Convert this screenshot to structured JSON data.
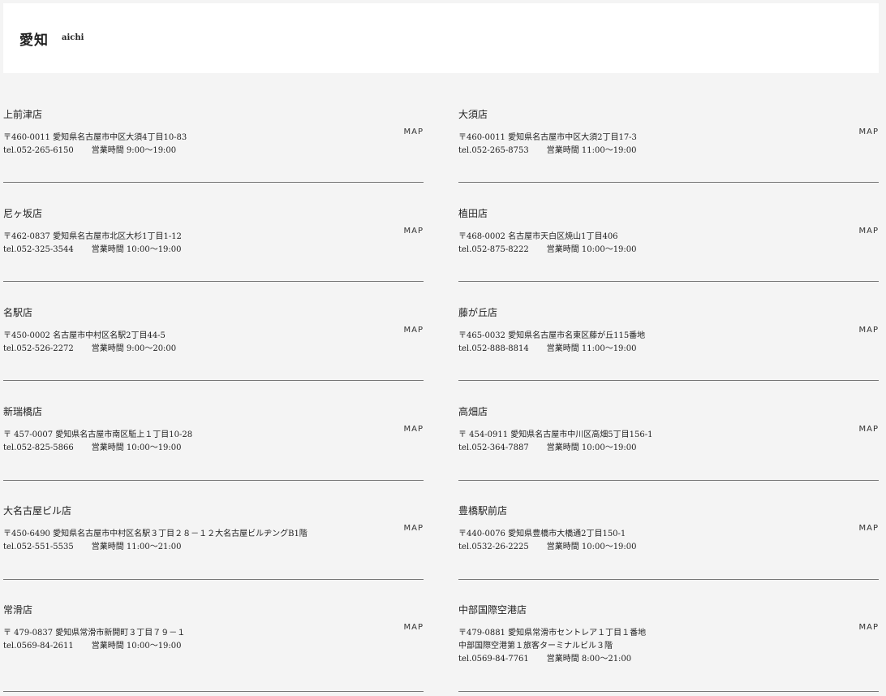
{
  "header": {
    "title": "愛知",
    "subtitle": "aichi"
  },
  "map_label": "MAP",
  "stores": [
    {
      "name": "上前津店",
      "address": "〒460-0011 愛知県名古屋市中区大須4丁目10-83",
      "tel": "tel.052-265-6150",
      "hours": "営業時間 9:00～19:00"
    },
    {
      "name": "大須店",
      "address": "〒460-0011 愛知県名古屋市中区大須2丁目17-3",
      "tel": "tel.052-265-8753",
      "hours": "営業時間 11:00～19:00"
    },
    {
      "name": "尼ヶ坂店",
      "address": "〒462-0837 愛知県名古屋市北区大杉1丁目1-12",
      "tel": "tel.052-325-3544",
      "hours": "営業時間 10:00～19:00"
    },
    {
      "name": "植田店",
      "address": "〒468-0002 名古屋市天白区焼山1丁目406",
      "tel": "tel.052-875-8222",
      "hours": "営業時間 10:00～19:00"
    },
    {
      "name": "名駅店",
      "address": "〒450-0002 名古屋市中村区名駅2丁目44-5",
      "tel": "tel.052-526-2272",
      "hours": "営業時間 9:00～20:00"
    },
    {
      "name": "藤が丘店",
      "address": "〒465-0032 愛知県名古屋市名東区藤が丘115番地",
      "tel": "tel.052-888-8814",
      "hours": "営業時間 11:00～19:00"
    },
    {
      "name": "新瑞橋店",
      "address": "〒 457-0007 愛知県名古屋市南区駈上１丁目10-28",
      "tel": "tel.052-825-5866",
      "hours": "営業時間 10:00～19:00"
    },
    {
      "name": "高畑店",
      "address": "〒 454-0911 愛知県名古屋市中川区高畑5丁目156-1",
      "tel": "tel.052-364-7887",
      "hours": "営業時間 10:00～19:00"
    },
    {
      "name": "大名古屋ビル店",
      "address": "〒450-6490 愛知県名古屋市中村区名駅３丁目２８－１２大名古屋ビルヂングB1階",
      "tel": "tel.052-551-5535",
      "hours": "営業時間 11:00～21:00"
    },
    {
      "name": "豊橋駅前店",
      "address": "〒440-0076 愛知県豊橋市大橋通2丁目150-1",
      "tel": "tel.0532-26-2225",
      "hours": "営業時間 10:00～19:00"
    },
    {
      "name": "常滑店",
      "address": "〒 479-0837 愛知県常滑市新開町３丁目７９－１",
      "tel": "tel.0569-84-2611",
      "hours": "営業時間 10:00～19:00"
    },
    {
      "name": "中部国際空港店",
      "address": "〒479-0881 愛知県常滑市セントレア１丁目１番地",
      "address2": "中部国際空港第１旅客ターミナルビル３階",
      "tel": "tel.0569-84-7761",
      "hours": "営業時間 8:00～21:00"
    }
  ]
}
